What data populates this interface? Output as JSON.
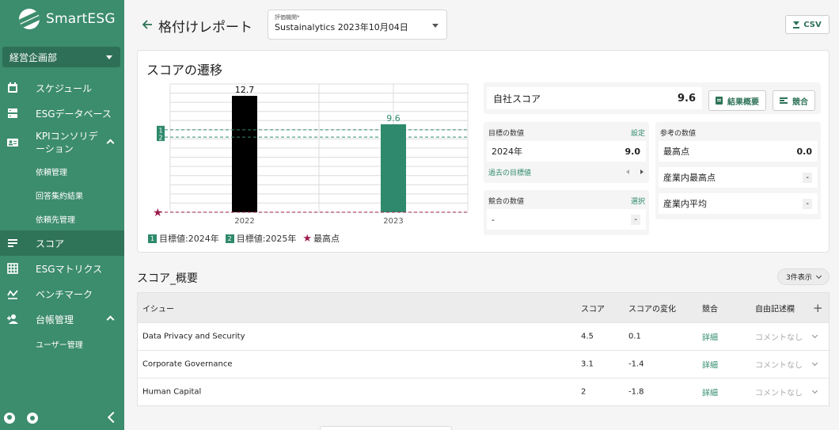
{
  "brand": {
    "name": "SmartESG"
  },
  "sidebar": {
    "department": "経営企画部",
    "items": [
      {
        "label": "スケジュール",
        "icon": "calendar-icon"
      },
      {
        "label": "ESGデータベース",
        "icon": "database-icon"
      },
      {
        "label": "KPIコンソリデーション",
        "icon": "id-card-icon",
        "expanded": true,
        "sub": [
          "依頼管理",
          "回答集約結果",
          "依頼先管理"
        ]
      },
      {
        "label": "スコア",
        "icon": "score-icon",
        "active": true
      },
      {
        "label": "ESGマトリクス",
        "icon": "grid-icon"
      },
      {
        "label": "ベンチマーク",
        "icon": "benchmark-icon"
      },
      {
        "label": "台帳管理",
        "icon": "add-user-icon",
        "expanded": true,
        "sub": [
          "ユーザー管理"
        ]
      }
    ]
  },
  "header": {
    "title": "格付けレポート",
    "select_label": "評価機関*",
    "select_value": "Sustainalytics 2023年10月04日",
    "csv_label": "CSV"
  },
  "score_panel": {
    "title": "スコアの遷移",
    "self_score_label": "自社スコア",
    "self_score_value": "9.6",
    "summary_button": "結果概要",
    "compete_button": "競合",
    "target": {
      "heading": "目標の数値",
      "action": "設定",
      "year": "2024年",
      "value": "9.0",
      "past_link": "過去の目標値"
    },
    "competitor": {
      "heading": "競合の数値",
      "action": "選択",
      "name": "-",
      "value": "-"
    },
    "reference": {
      "heading": "参考の数値",
      "rows": [
        {
          "label": "最高点",
          "value": "0.0"
        },
        {
          "label": "産業内最高点",
          "value": "-"
        },
        {
          "label": "産業内平均",
          "value": "-"
        }
      ]
    }
  },
  "legend": {
    "target1_marker": "1",
    "target1_label": "目標値:2024年",
    "target2_marker": "2",
    "target2_label": "目標値:2025年",
    "max_label": "最高点"
  },
  "chart_data": {
    "type": "bar",
    "categories": [
      "2022",
      "2023"
    ],
    "values": [
      12.7,
      9.6
    ],
    "value_labels": [
      "12.7",
      "9.6"
    ],
    "bar_colors": [
      "#000000",
      "#2f8a6d"
    ],
    "value_label_colors": [
      "#111111",
      "#2f8a6d"
    ],
    "ylim": [
      0,
      14
    ],
    "reference_lines": [
      {
        "marker": "1",
        "value": 9.0,
        "color": "#2f8a6d",
        "style": "dashed"
      },
      {
        "marker": "2",
        "value": 8.2,
        "color": "#2f8a6d",
        "style": "dashed"
      },
      {
        "marker": "star",
        "value": 0.0,
        "color": "#9c1d4f",
        "style": "dashed"
      }
    ],
    "grid": true,
    "title": "",
    "xlabel": "",
    "ylabel": ""
  },
  "summary": {
    "title": "スコア_概要",
    "count_button": "3件表示",
    "columns": [
      "イシュー",
      "スコア",
      "スコアの変化",
      "競合",
      "自由記述欄"
    ],
    "add_symbol": "+",
    "rows": [
      {
        "issue": "Data Privacy and Security",
        "score": "4.5",
        "change": "0.1",
        "compete": "詳細",
        "comment": "コメントなし"
      },
      {
        "issue": "Corporate Governance",
        "score": "3.1",
        "change": "-1.4",
        "compete": "詳細",
        "comment": "コメントなし"
      },
      {
        "issue": "Human Capital",
        "score": "2",
        "change": "-1.8",
        "compete": "詳細",
        "comment": "コメントなし"
      }
    ]
  }
}
